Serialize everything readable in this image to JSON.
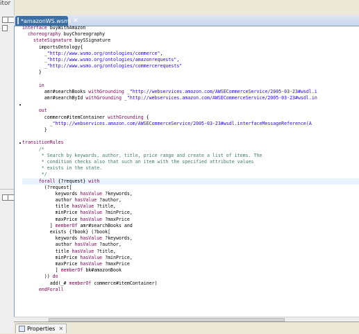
{
  "left": {
    "top_label": "itor"
  },
  "editor": {
    "tab_label": "*amazonWS.wsml",
    "tab_close": "✕",
    "lines": [
      [
        {
          "c": "kw",
          "t": "interface"
        },
        {
          "t": " buyWithAmazon"
        }
      ],
      [
        {
          "t": "  "
        },
        {
          "c": "kw",
          "t": "choreography"
        },
        {
          "t": " buyChoreography"
        }
      ],
      [
        {
          "t": "    "
        },
        {
          "c": "kw",
          "t": "stateSignature"
        },
        {
          "t": " buySSignature"
        }
      ],
      [
        {
          "t": "      importsOntology{"
        }
      ],
      [
        {
          "t": "        _"
        },
        {
          "c": "str",
          "t": "\"http://www.wsmo.org/ontologies/commerce\""
        },
        {
          "t": ","
        }
      ],
      [
        {
          "t": "        _"
        },
        {
          "c": "str",
          "t": "\"http://www.wsmo.org/ontologies/amazonrequests\""
        },
        {
          "t": ","
        }
      ],
      [
        {
          "t": "        _"
        },
        {
          "c": "str",
          "t": "\"http://www.wsmo.org/ontologies/commercerequests\""
        }
      ],
      [
        {
          "t": "      }"
        }
      ],
      [
        {
          "t": ""
        }
      ],
      [
        {
          "t": "      "
        },
        {
          "c": "kw",
          "t": "in"
        }
      ],
      [
        {
          "t": "        amr#searchBooks "
        },
        {
          "c": "kw",
          "t": "withGrounding"
        },
        {
          "t": " _"
        },
        {
          "c": "str",
          "t": "\"http://webservices.amazon.com/AWSECommerceService/2005-03-23#wsdl.i"
        }
      ],
      [
        {
          "t": "        amr#searchById "
        },
        {
          "c": "kw",
          "t": "withGrounding"
        },
        {
          "t": " _"
        },
        {
          "c": "str",
          "t": "\"http://webservices.amazon.com/AWSECommerceService/2005-03-23#wsdl.in"
        }
      ],
      [
        {
          "t": ""
        }
      ],
      [
        {
          "t": "      "
        },
        {
          "c": "kw",
          "t": "out"
        }
      ],
      [
        {
          "t": "        commerce#itemContainer "
        },
        {
          "c": "kw",
          "t": "withGrounding"
        },
        {
          "t": " {"
        }
      ],
      [
        {
          "t": "          _"
        },
        {
          "c": "str",
          "t": "\"http://webservices.amazon.com/AWSECommerceService/2005-03-23#wsdl.interfaceMessageReference(A"
        }
      ],
      [
        {
          "t": "        }"
        }
      ],
      [
        {
          "t": ""
        }
      ],
      [
        {
          "c": "kw",
          "t": "transitionRules"
        }
      ],
      [
        {
          "t": "      "
        },
        {
          "c": "cm",
          "t": "/*"
        }
      ],
      [
        {
          "t": "       "
        },
        {
          "c": "cm",
          "t": "* Search by keywords, author, title, price range and create a list of items. The"
        }
      ],
      [
        {
          "t": "       "
        },
        {
          "c": "cm",
          "t": "* condition checks also that such an item with the specified attribute values"
        }
      ],
      [
        {
          "t": "       "
        },
        {
          "c": "cm",
          "t": "* exists in the state."
        }
      ],
      [
        {
          "t": "       "
        },
        {
          "c": "cm",
          "t": "*/"
        }
      ],
      [
        {
          "t": "      "
        },
        {
          "c": "kw",
          "t": "forall"
        },
        {
          "t": " {?request} "
        },
        {
          "c": "kw",
          "t": "with"
        }
      ],
      [
        {
          "t": "        (?request["
        }
      ],
      [
        {
          "t": "            keywords "
        },
        {
          "c": "kw",
          "t": "hasValue"
        },
        {
          "t": " ?keywords,"
        }
      ],
      [
        {
          "t": "            author "
        },
        {
          "c": "kw",
          "t": "hasValue"
        },
        {
          "t": " ?author,"
        }
      ],
      [
        {
          "t": "            title "
        },
        {
          "c": "kw",
          "t": "hasValue"
        },
        {
          "t": " ?title,"
        }
      ],
      [
        {
          "t": "            minPrice "
        },
        {
          "c": "kw",
          "t": "hasValue"
        },
        {
          "t": " ?minPrice,"
        }
      ],
      [
        {
          "t": "            maxPrice "
        },
        {
          "c": "kw",
          "t": "hasValue"
        },
        {
          "t": " ?maxPrice"
        }
      ],
      [
        {
          "t": "          ] "
        },
        {
          "c": "kw",
          "t": "memberOf"
        },
        {
          "t": " amr#searchBooks and"
        }
      ],
      [
        {
          "t": "          exists {?book} (?book["
        }
      ],
      [
        {
          "t": "            keywords "
        },
        {
          "c": "kw",
          "t": "hasValue"
        },
        {
          "t": " ?keywords,"
        }
      ],
      [
        {
          "t": "            author "
        },
        {
          "c": "kw",
          "t": "hasValue"
        },
        {
          "t": " ?author,"
        }
      ],
      [
        {
          "t": "            title "
        },
        {
          "c": "kw",
          "t": "hasValue"
        },
        {
          "t": " ?title,"
        }
      ],
      [
        {
          "t": "            minPrice "
        },
        {
          "c": "kw",
          "t": "hasValue"
        },
        {
          "t": " ?minPrice,"
        }
      ],
      [
        {
          "t": "            maxPrice "
        },
        {
          "c": "kw",
          "t": "hasValue"
        },
        {
          "t": " ?maxPrice"
        }
      ],
      [
        {
          "t": "            ] "
        },
        {
          "c": "kw",
          "t": "memberOf"
        },
        {
          "t": " bk#amazonBook"
        }
      ],
      [
        {
          "t": "        )) "
        },
        {
          "c": "kw",
          "t": "do"
        }
      ],
      [
        {
          "t": "          add(_# "
        },
        {
          "c": "kw",
          "t": "memberOf"
        },
        {
          "t": " commerce#itemContainer)"
        }
      ],
      [
        {
          "t": "      "
        },
        {
          "c": "kw",
          "t": "endForall"
        }
      ]
    ],
    "highlighted_line": 24
  },
  "properties": {
    "tab_label": "Properties",
    "tab_close": "✕"
  },
  "colors": {
    "keyword": "#7f0055",
    "string": "#2a00ff",
    "comment": "#3f7f5f",
    "tab_active": "#3a6ea5"
  }
}
